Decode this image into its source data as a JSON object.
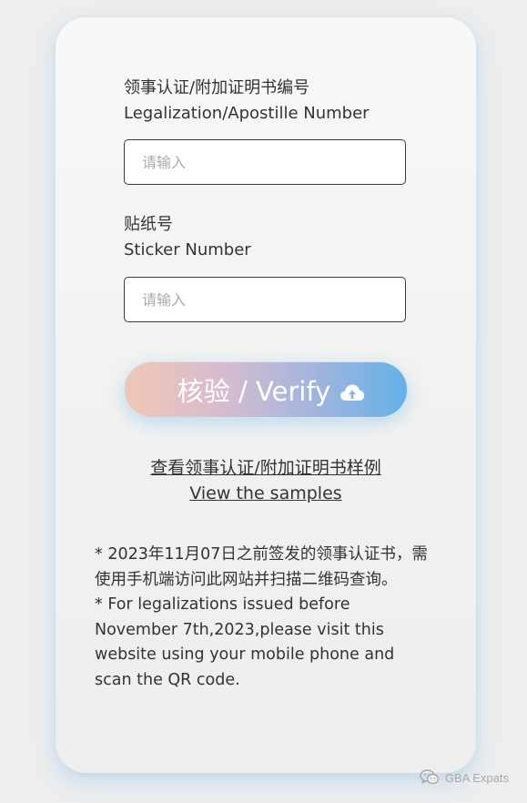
{
  "form": {
    "legalization_number": {
      "label_zh": "领事认证/附加证明书编号",
      "label_en": "Legalization/Apostille Number",
      "placeholder": "请输入",
      "value": ""
    },
    "sticker_number": {
      "label_zh": "贴纸号",
      "label_en": "Sticker Number",
      "placeholder": "请输入",
      "value": ""
    },
    "verify_button": {
      "label": "核验 / Verify",
      "icon": "cloud-upload-icon"
    }
  },
  "samples_link": {
    "label_zh": "查看领事认证/附加证明书样例",
    "label_en": "View the samples"
  },
  "note": {
    "zh": "* 2023年11月07日之前签发的领事认证书，需使用手机端访问此网站并扫描二维码查询。",
    "en": "* For legalizations issued before November 7th,2023,please visit this website using your mobile phone and scan the QR code."
  },
  "watermark": {
    "text": "GBA Expats",
    "icon": "wechat-icon"
  },
  "colors": {
    "button_gradient_start": "#f0c7b4",
    "button_gradient_end": "#64b1e8",
    "text": "#333333",
    "placeholder": "#aaaaaa"
  }
}
